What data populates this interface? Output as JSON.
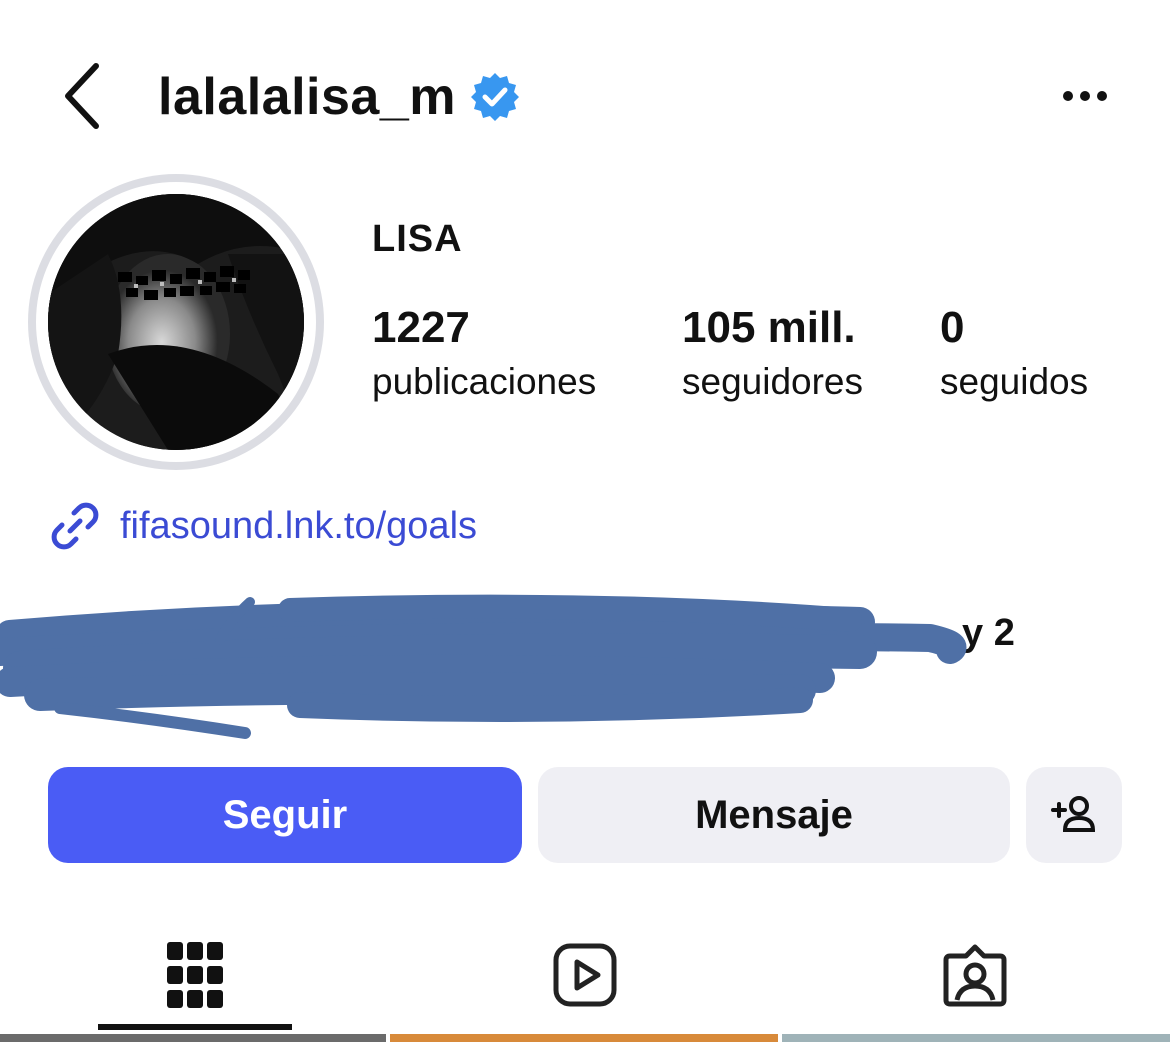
{
  "header": {
    "username": "lalalalisa_m",
    "verified": true,
    "icons": {
      "back": "chevron-left-icon",
      "verified": "verified-badge-icon",
      "more": "more-horizontal-icon"
    }
  },
  "profile": {
    "display_name": "LISA",
    "stats": [
      {
        "value": "1227",
        "label": "publicaciones"
      },
      {
        "value": "105 mill.",
        "label": "seguidores"
      },
      {
        "value": "0",
        "label": "seguidos"
      }
    ],
    "link": {
      "text": "fifasound.lnk.to/goals",
      "icon": "link-icon"
    },
    "followed_by_tail": "y 2"
  },
  "actions": {
    "follow_label": "Seguir",
    "message_label": "Mensaje",
    "add_user_icon": "add-user-icon"
  },
  "tabs": [
    {
      "icon": "grid-icon",
      "selected": true
    },
    {
      "icon": "reels-icon",
      "selected": false
    },
    {
      "icon": "tagged-icon",
      "selected": false
    }
  ],
  "colors": {
    "accent": "#4a5cf5",
    "link": "#3b4bd4",
    "verified": "#3897f0",
    "secondary_button": "#efeff4",
    "redaction": "#4f70a6"
  }
}
